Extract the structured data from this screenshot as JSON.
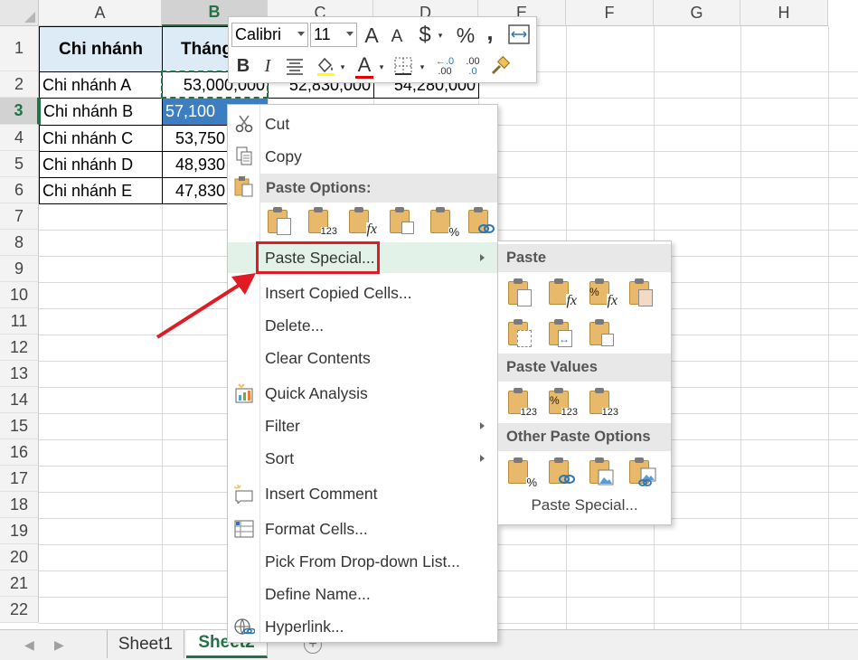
{
  "columns": [
    "A",
    "B",
    "C",
    "D",
    "E",
    "F",
    "G",
    "H"
  ],
  "rows": [
    "1",
    "2",
    "3",
    "4",
    "5",
    "6",
    "7",
    "8",
    "9",
    "10",
    "11",
    "12",
    "13",
    "14",
    "15",
    "16",
    "17",
    "18",
    "19",
    "20",
    "21",
    "22"
  ],
  "table": {
    "header": [
      "Chi nhánh",
      "Tháng",
      "",
      ""
    ],
    "rows": [
      [
        "Chi nhánh A",
        "53,000,000",
        "52,830,000",
        "54,280,000"
      ],
      [
        "Chi nhánh B",
        "57,100",
        "",
        ""
      ],
      [
        "Chi nhánh C",
        "53,750",
        "",
        ""
      ],
      [
        "Chi nhánh D",
        "48,930",
        "",
        ""
      ],
      [
        "Chi nhánh E",
        "47,830",
        "",
        ""
      ]
    ]
  },
  "mini_toolbar": {
    "font_name": "Calibri",
    "font_size": "11",
    "grow_font": "A",
    "shrink_font": "A",
    "currency": "$",
    "percent": "%",
    "comma": ",",
    "bold": "B",
    "italic": "I",
    "font_color": "A",
    "inc_decimal": ".00",
    "dec_decimal": ".0"
  },
  "context_menu": {
    "cut": "Cut",
    "copy": "Copy",
    "paste_options_title": "Paste Options:",
    "paste_special": "Paste Special...",
    "insert_copied_cells": "Insert Copied Cells...",
    "delete": "Delete...",
    "clear_contents": "Clear Contents",
    "quick_analysis": "Quick Analysis",
    "filter": "Filter",
    "sort": "Sort",
    "insert_comment": "Insert Comment",
    "format_cells": "Format Cells...",
    "pick_from_list": "Pick From Drop-down List...",
    "define_name": "Define Name...",
    "hyperlink": "Hyperlink..."
  },
  "submenu": {
    "paste_title": "Paste",
    "paste_values_title": "Paste Values",
    "other_title": "Other Paste Options",
    "footer": "Paste Special...",
    "tag_123": "123",
    "tag_fx": "fx",
    "tag_percent": "%"
  },
  "sheets": {
    "tabs": [
      "Sheet1",
      "Sheet2"
    ],
    "active": "Sheet2"
  },
  "colors": {
    "accent_green": "#217346",
    "header_fill": "#ddebf7",
    "selection_blue": "#3d7dc2",
    "callout_red": "#e01b24"
  }
}
